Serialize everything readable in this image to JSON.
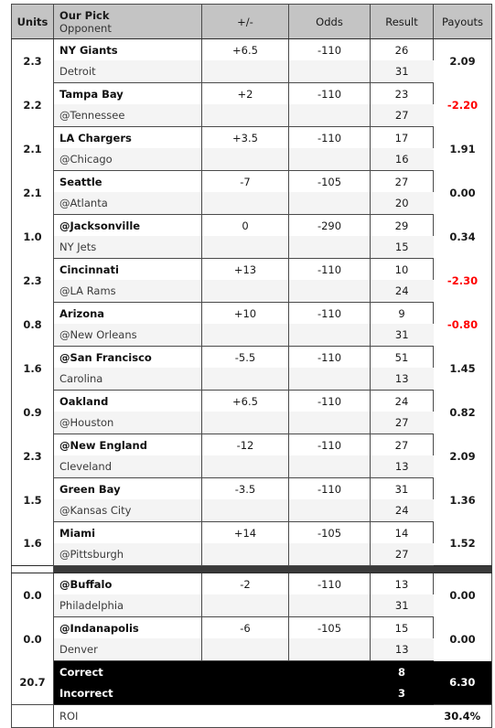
{
  "table": {
    "headers": {
      "units": "Units",
      "pick": "Our Pick",
      "opponent": "Opponent",
      "spread": "+/-",
      "odds": "Odds",
      "result": "Result",
      "payouts": "Payouts"
    },
    "colors": {
      "header_background": "#c4c4c4",
      "negative_payout": "#ff0000",
      "totals_background": "#000000",
      "separator": "#3a3a3a",
      "alt_row": "#f4f4f4"
    },
    "rows": [
      {
        "units": "2.3",
        "pick": "NY Giants",
        "opponent": "Detroit",
        "spread": "+6.5",
        "odds": "-110",
        "result_pick": "26",
        "result_opp": "31",
        "payout": "2.09",
        "payout_negative": false
      },
      {
        "units": "2.2",
        "pick": "Tampa Bay",
        "opponent": "@Tennessee",
        "spread": "+2",
        "odds": "-110",
        "result_pick": "23",
        "result_opp": "27",
        "payout": "-2.20",
        "payout_negative": true
      },
      {
        "units": "2.1",
        "pick": "LA Chargers",
        "opponent": "@Chicago",
        "spread": "+3.5",
        "odds": "-110",
        "result_pick": "17",
        "result_opp": "16",
        "payout": "1.91",
        "payout_negative": false
      },
      {
        "units": "2.1",
        "pick": "Seattle",
        "opponent": "@Atlanta",
        "spread": "-7",
        "odds": "-105",
        "result_pick": "27",
        "result_opp": "20",
        "payout": "0.00",
        "payout_negative": false
      },
      {
        "units": "1.0",
        "pick": "@Jacksonville",
        "opponent": "NY Jets",
        "spread": "0",
        "odds": "-290",
        "result_pick": "29",
        "result_opp": "15",
        "payout": "0.34",
        "payout_negative": false
      },
      {
        "units": "2.3",
        "pick": "Cincinnati",
        "opponent": "@LA Rams",
        "spread": "+13",
        "odds": "-110",
        "result_pick": "10",
        "result_opp": "24",
        "payout": "-2.30",
        "payout_negative": true
      },
      {
        "units": "0.8",
        "pick": "Arizona",
        "opponent": "@New Orleans",
        "spread": "+10",
        "odds": "-110",
        "result_pick": "9",
        "result_opp": "31",
        "payout": "-0.80",
        "payout_negative": true
      },
      {
        "units": "1.6",
        "pick": "@San Francisco",
        "opponent": "Carolina",
        "spread": "-5.5",
        "odds": "-110",
        "result_pick": "51",
        "result_opp": "13",
        "payout": "1.45",
        "payout_negative": false
      },
      {
        "units": "0.9",
        "pick": "Oakland",
        "opponent": "@Houston",
        "spread": "+6.5",
        "odds": "-110",
        "result_pick": "24",
        "result_opp": "27",
        "payout": "0.82",
        "payout_negative": false
      },
      {
        "units": "2.3",
        "pick": "@New England",
        "opponent": "Cleveland",
        "spread": "-12",
        "odds": "-110",
        "result_pick": "27",
        "result_opp": "13",
        "payout": "2.09",
        "payout_negative": false
      },
      {
        "units": "1.5",
        "pick": "Green Bay",
        "opponent": "@Kansas City",
        "spread": "-3.5",
        "odds": "-110",
        "result_pick": "31",
        "result_opp": "24",
        "payout": "1.36",
        "payout_negative": false
      },
      {
        "units": "1.6",
        "pick": "Miami",
        "opponent": "@Pittsburgh",
        "spread": "+14",
        "odds": "-105",
        "result_pick": "14",
        "result_opp": "27",
        "payout": "1.52",
        "payout_negative": false
      }
    ],
    "rows_after_separator": [
      {
        "units": "0.0",
        "pick": "@Buffalo",
        "opponent": "Philadelphia",
        "spread": "-2",
        "odds": "-110",
        "result_pick": "13",
        "result_opp": "31",
        "payout": "0.00",
        "payout_negative": false
      },
      {
        "units": "0.0",
        "pick": "@Indanapolis",
        "opponent": "Denver",
        "spread": "-6",
        "odds": "-105",
        "result_pick": "15",
        "result_opp": "13",
        "payout": "0.00",
        "payout_negative": false
      }
    ],
    "totals": {
      "units": "20.7",
      "correct_label": "Correct",
      "incorrect_label": "Incorrect",
      "correct_count": "8",
      "incorrect_count": "3",
      "payout": "6.30"
    },
    "roi": {
      "label": "ROI",
      "value": "30.4%"
    }
  }
}
